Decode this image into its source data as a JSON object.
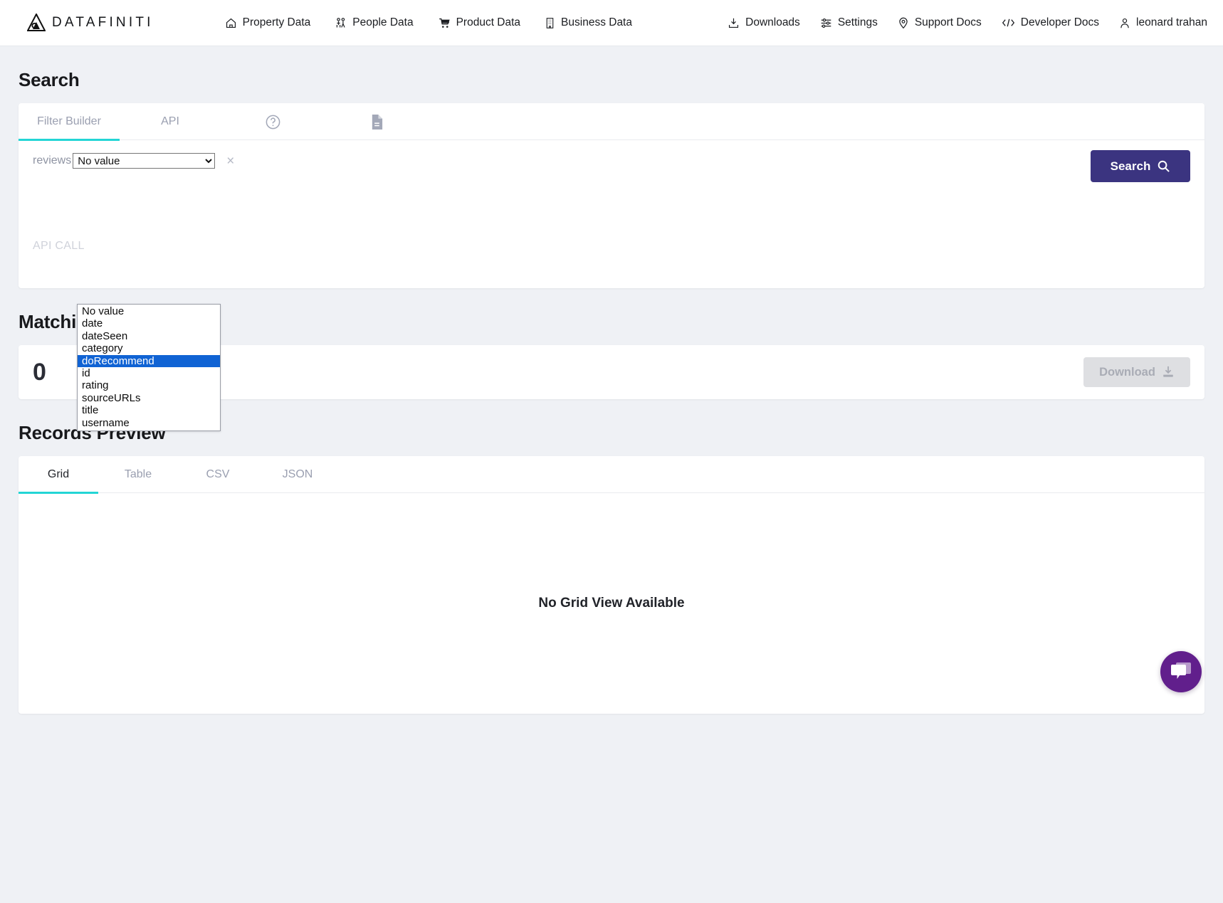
{
  "header": {
    "brand_name": "DATAFINITI",
    "brand_icon": "datafiniti-logo-icon",
    "left_nav": [
      {
        "label": "Property Data",
        "icon": "home-icon"
      },
      {
        "label": "People Data",
        "icon": "people-icon"
      },
      {
        "label": "Product Data",
        "icon": "shopping-cart-icon"
      },
      {
        "label": "Business Data",
        "icon": "building-icon"
      }
    ],
    "right_nav": [
      {
        "label": "Downloads",
        "icon": "download-icon"
      },
      {
        "label": "Settings",
        "icon": "sliders-icon"
      },
      {
        "label": "Support Docs",
        "icon": "map-pin-icon"
      },
      {
        "label": "Developer Docs",
        "icon": "code-brackets-icon"
      },
      {
        "label": "leonard trahan",
        "icon": "user-icon"
      }
    ]
  },
  "search_section": {
    "title": "Search",
    "tabs": [
      {
        "label": "Filter Builder",
        "active": true,
        "type": "text"
      },
      {
        "label": "API",
        "active": false,
        "type": "text"
      },
      {
        "label": "",
        "active": false,
        "type": "icon",
        "icon": "help-circle-icon"
      },
      {
        "label": "",
        "active": false,
        "type": "icon",
        "icon": "document-icon"
      }
    ],
    "filter": {
      "field_label": "reviews",
      "select_value": "No value",
      "remove_label": "×",
      "options": [
        "No value",
        "date",
        "dateSeen",
        "category",
        "doRecommend",
        "id",
        "rating",
        "sourceURLs",
        "title",
        "username"
      ],
      "highlighted_option": "doRecommend"
    },
    "api_call_label": "API CALL",
    "search_button": {
      "label": "Search",
      "icon": "search-icon",
      "color": "#3b3480"
    }
  },
  "matching_records": {
    "title": "Matching Records",
    "count": "0",
    "download_button": {
      "label": "Download",
      "icon": "download-tray-icon",
      "disabled": true
    }
  },
  "records_preview": {
    "title": "Records Preview",
    "tabs": [
      {
        "label": "Grid",
        "active": true
      },
      {
        "label": "Table",
        "active": false
      },
      {
        "label": "CSV",
        "active": false
      },
      {
        "label": "JSON",
        "active": false
      }
    ],
    "empty_message": "No Grid View Available"
  },
  "chat_widget": {
    "icon": "chat-bubbles-icon",
    "color": "#611f8c"
  },
  "theme": {
    "accent_teal": "#23d5d5",
    "page_bg": "#eff1f5",
    "card_bg": "#ffffff",
    "muted_text": "#9a9fb0",
    "highlight_blue": "#1063d4"
  }
}
